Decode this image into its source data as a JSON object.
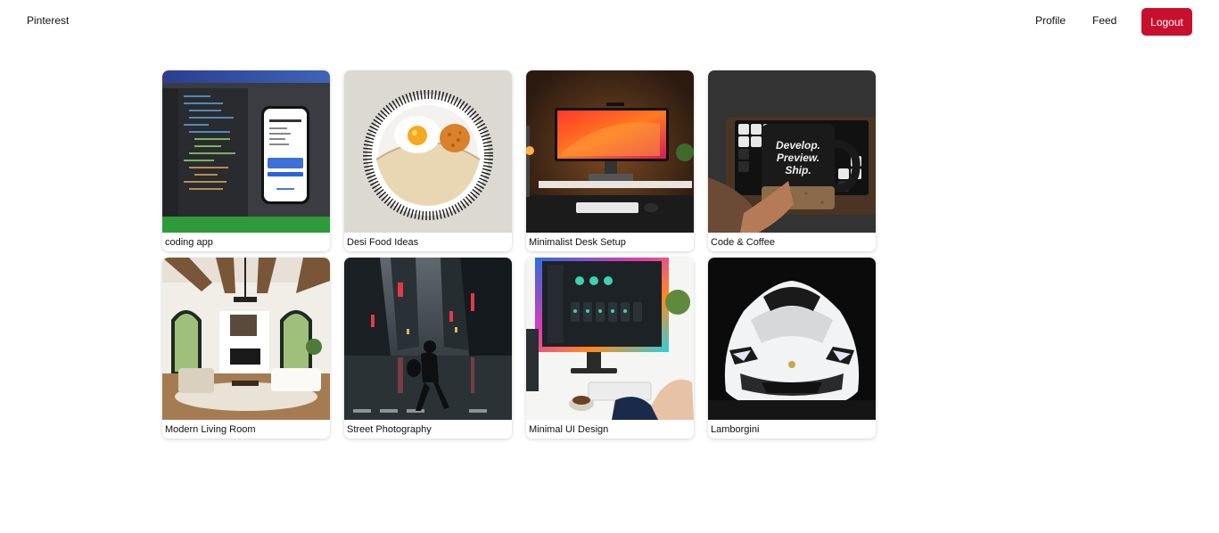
{
  "nav": {
    "brand": "Pinterest",
    "profile": "Profile",
    "feed": "Feed",
    "logout": "Logout",
    "logout_color": "#c8102e"
  },
  "pins": [
    {
      "title": "coding app",
      "image": "ide-with-phone-simulator"
    },
    {
      "title": "Desi Food Ideas",
      "image": "plate-with-egg-and-dosa"
    },
    {
      "title": "Minimalist Desk Setup",
      "image": "monitor-desk-setup"
    },
    {
      "title": "Code & Coffee",
      "image": "mug-over-keyboard"
    },
    {
      "title": "Modern Living Room",
      "image": "bright-living-room"
    },
    {
      "title": "Street Photography",
      "image": "rainy-street-walker"
    },
    {
      "title": "Minimal UI Design",
      "image": "monitor-dashboard-ui"
    },
    {
      "title": "Lamborgini",
      "image": "white-sports-car"
    }
  ],
  "mug_text": [
    "Develop.",
    "Preview.",
    "Ship."
  ]
}
